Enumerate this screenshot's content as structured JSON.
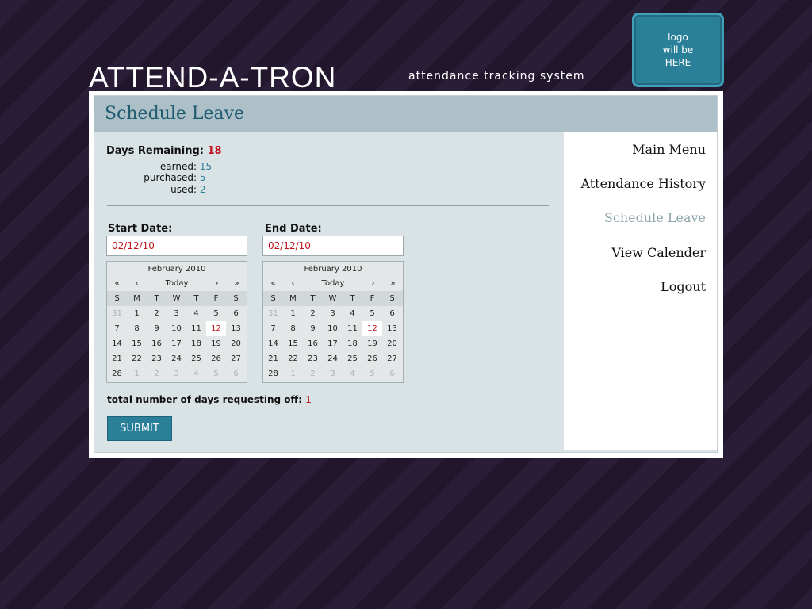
{
  "header": {
    "title": "ATTEND-A-TRON",
    "subtitle": "attendance tracking system",
    "logo_text": "logo\nwill be\nHERE"
  },
  "page": {
    "title": "Schedule Leave"
  },
  "nav": {
    "items": [
      {
        "label": "Main Menu"
      },
      {
        "label": "Attendance History"
      },
      {
        "label": "Schedule Leave",
        "active": true
      },
      {
        "label": "View Calender"
      },
      {
        "label": "Logout"
      }
    ]
  },
  "summary": {
    "days_label": "Days Remaining:",
    "days_value": "18",
    "earned_label": "earned:",
    "earned_value": "15",
    "purchased_label": "purchased:",
    "purchased_value": "5",
    "used_label": "used:",
    "used_value": "2"
  },
  "start": {
    "label": "Start Date:",
    "value": "02/12/10",
    "calendar": {
      "month": "February 2010",
      "nav": [
        "«",
        "‹",
        "Today",
        "›",
        "»"
      ],
      "weekdays": [
        "S",
        "M",
        "T",
        "W",
        "T",
        "F",
        "S"
      ],
      "weeks": [
        [
          "31",
          "1",
          "2",
          "3",
          "4",
          "5",
          "6"
        ],
        [
          "7",
          "8",
          "9",
          "10",
          "11",
          "12",
          "13"
        ],
        [
          "14",
          "15",
          "16",
          "17",
          "18",
          "19",
          "20"
        ],
        [
          "21",
          "22",
          "23",
          "24",
          "25",
          "26",
          "27"
        ],
        [
          "28",
          "1",
          "2",
          "3",
          "4",
          "5",
          "6"
        ]
      ]
    }
  },
  "end": {
    "label": "End Date:",
    "value": "02/12/10",
    "calendar": {
      "month": "February 2010",
      "nav": [
        "«",
        "‹",
        "Today",
        "›",
        "»"
      ],
      "weekdays": [
        "S",
        "M",
        "T",
        "W",
        "T",
        "F",
        "S"
      ],
      "weeks": [
        [
          "31",
          "1",
          "2",
          "3",
          "4",
          "5",
          "6"
        ],
        [
          "7",
          "8",
          "9",
          "10",
          "11",
          "12",
          "13"
        ],
        [
          "14",
          "15",
          "16",
          "17",
          "18",
          "19",
          "20"
        ],
        [
          "21",
          "22",
          "23",
          "24",
          "25",
          "26",
          "27"
        ],
        [
          "28",
          "1",
          "2",
          "3",
          "4",
          "5",
          "6"
        ]
      ]
    }
  },
  "total": {
    "label": "total number of days requesting off:",
    "value": "1"
  },
  "submit": {
    "label": "SUBMIT"
  },
  "colors": {
    "accent": "#2a7f99",
    "highlight": "#c0141e",
    "background": "#241830",
    "title_bar": "#adc0c7",
    "panel": "#d9e2e5"
  }
}
